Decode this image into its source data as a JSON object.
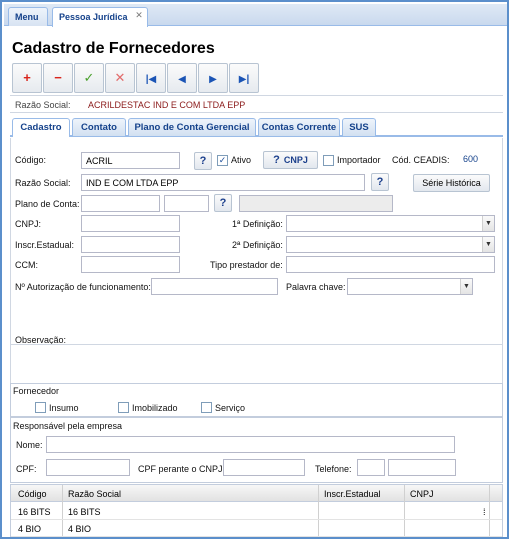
{
  "top_tabs": [
    {
      "label": "Menu"
    },
    {
      "label": "Pessoa Jurídica"
    }
  ],
  "close_glyph": "✕",
  "title": "Cadastro de Fornecedores",
  "toolbar": {
    "icons": [
      "plus-icon",
      "minus-icon",
      "check-icon",
      "x-icon",
      "first-icon",
      "prev-icon",
      "next-icon",
      "last-icon"
    ],
    "glyphs": [
      "+",
      "−",
      "✓",
      "✕",
      "|◀",
      "◀",
      "▶",
      "▶|"
    ],
    "colors": [
      "#d9241b",
      "#d9241b",
      "#4aa02c",
      "#e26c6c",
      "#1b54b5",
      "#1b54b5",
      "#1b54b5",
      "#1b54b5"
    ]
  },
  "razao_header": {
    "label": "Razão Social:",
    "value": "ACRILDESTAC IND E COM LTDA EPP"
  },
  "main_tabs": [
    "Cadastro",
    "Contato",
    "Plano de Conta Gerencial",
    "Contas Corrente",
    "SUS"
  ],
  "form": {
    "codigo_label": "Código:",
    "codigo_value": "ACRIL",
    "ativo_label": "Ativo",
    "cnpj_button": "CNPJ",
    "importador_label": "Importador",
    "cod_ceadis_label": "Cód. CEADIS:",
    "cod_ceadis_value": "600",
    "razao_label": "Razão Social:",
    "razao_value": "IND E COM LTDA EPP",
    "serie_button": "Série Histórica",
    "plano_label": "Plano de Conta:",
    "cnpj_label": "CNPJ:",
    "def1_label": "1ª Definição:",
    "inscr_label": "Inscr.Estadual:",
    "def2_label": "2ª Definição:",
    "ccm_label": "CCM:",
    "tipo_label": "Tipo prestador de:",
    "autorizacao_label": "Nº Autorização de funcionamento:",
    "palavra_label": "Palavra chave:",
    "observacao_label": "Observação:",
    "question_glyph": "?",
    "check_glyph": "✓",
    "dropdown_glyph": "▼"
  },
  "fornecedor": {
    "title": "Fornecedor",
    "options": [
      "Insumo",
      "Imobilizado",
      "Serviço"
    ]
  },
  "responsavel": {
    "title": "Responsável pela empresa",
    "nome_label": "Nome:",
    "cpf_label": "CPF:",
    "cpf_cnpj_label": "CPF perante o CNPJ:",
    "telefone_label": "Telefone:"
  },
  "grid": {
    "columns": [
      "Código",
      "Razão Social",
      "Inscr.Estadual",
      "CNPJ"
    ],
    "rows": [
      [
        "16 BITS",
        "16 BITS",
        "",
        ""
      ],
      [
        "4 BIO",
        "4 BIO",
        "",
        ""
      ]
    ],
    "ellipsis": "⁞"
  }
}
